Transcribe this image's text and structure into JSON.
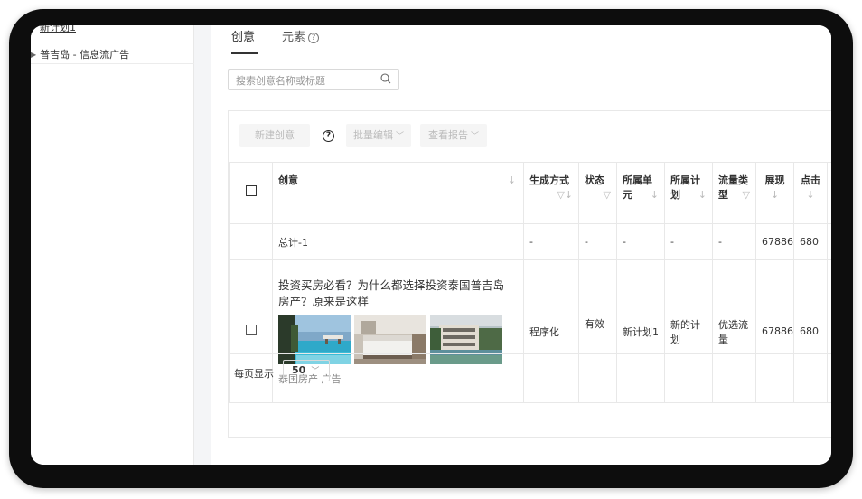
{
  "sidebar": {
    "items": [
      {
        "label": "新计划1"
      },
      {
        "label": "普吉岛 - 信息流广告"
      }
    ]
  },
  "tabs": [
    {
      "label": "创意"
    },
    {
      "label": "元素"
    }
  ],
  "search": {
    "placeholder": "搜索创意名称或标题"
  },
  "toolbar": {
    "new_label": "新建创意",
    "batch_label": "批量编辑",
    "report_label": "查看报告"
  },
  "table": {
    "headers": [
      "创意",
      "生成方式",
      "状态",
      "所属单元",
      "所属计划",
      "流量类型",
      "展现",
      "点击"
    ],
    "total_row": {
      "label": "总计-1",
      "method": "-",
      "status": "-",
      "unit": "-",
      "plan": "-",
      "traffic": "-",
      "impressions": "67886",
      "clicks": "680"
    },
    "rows": [
      {
        "title": "投资买房必看？为什么都选择投资泰国普吉岛房产？原来是这样",
        "subtitle": "泰国房产 广告",
        "method": "程序化",
        "status": "有效",
        "unit": "新计划1",
        "plan": "新的计划",
        "traffic": "优选流量",
        "impressions": "67886",
        "clicks": "680"
      }
    ]
  },
  "pagination": {
    "label": "每页显示",
    "page_size": "50"
  },
  "colors": {
    "accent": "#1677ff",
    "status_ok": "#52c41a"
  }
}
